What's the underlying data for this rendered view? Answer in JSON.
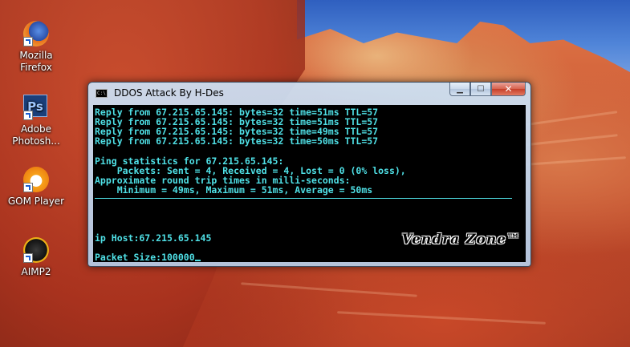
{
  "desktop": {
    "icons": [
      {
        "label": "Mozilla Firefox",
        "icon": "firefox-icon"
      },
      {
        "label": "Adobe Photosh...",
        "icon": "photoshop-icon",
        "glyph": "Ps"
      },
      {
        "label": "GOM Player",
        "icon": "gom-player-icon"
      },
      {
        "label": "AIMP2",
        "icon": "aimp-icon"
      }
    ]
  },
  "window": {
    "title": "DDOS Attack By H-Des",
    "controls": {
      "minimize": "▁",
      "maximize": "☐",
      "close": "✕"
    },
    "console": {
      "lines": [
        "Reply from 67.215.65.145: bytes=32 time=51ms TTL=57",
        "Reply from 67.215.65.145: bytes=32 time=51ms TTL=57",
        "Reply from 67.215.65.145: bytes=32 time=49ms TTL=57",
        "Reply from 67.215.65.145: bytes=32 time=50ms TTL=57",
        "",
        "Ping statistics for 67.215.65.145:",
        "    Packets: Sent = 4, Received = 4, Lost = 0 (0% loss),",
        "Approximate round trip times in milli-seconds:",
        "    Minimum = 49ms, Maximum = 51ms, Average = 50ms"
      ],
      "ip_host_line": "ip Host:67.215.65.145",
      "packet_size_line": "Packet Size:100000",
      "brand": "Vendra Zone™",
      "text_color": "#4fe0e6"
    }
  }
}
